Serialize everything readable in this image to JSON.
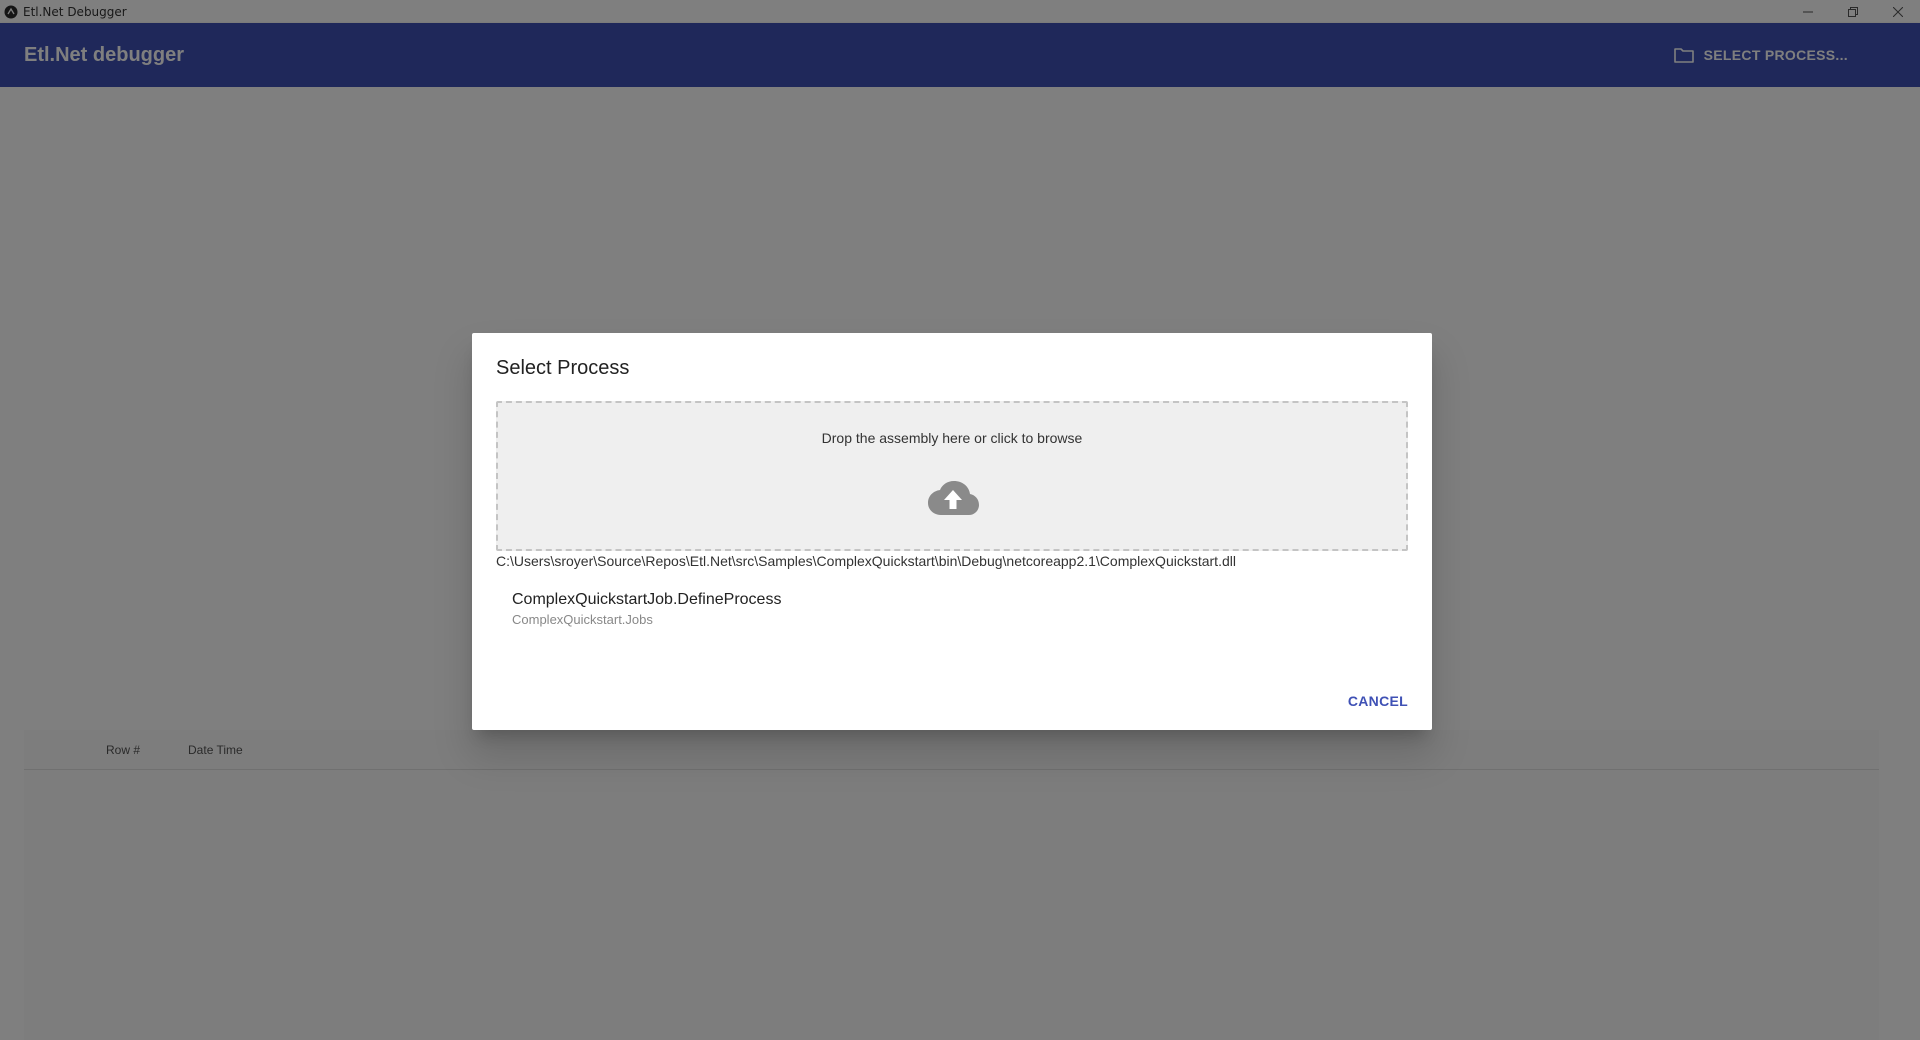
{
  "window": {
    "title": "Etl.Net Debugger",
    "icon": "app-logo-icon",
    "controls": [
      "minimize-icon",
      "restore-icon",
      "close-icon"
    ]
  },
  "appbar": {
    "title": "Etl.Net debugger",
    "select_process_label": "SELECT PROCESS...",
    "select_process_icon": "folder-icon",
    "color": "#3f51b5"
  },
  "grid": {
    "columns": [
      "Row #",
      "Date Time"
    ]
  },
  "dialog": {
    "title": "Select Process",
    "dropzone_text": "Drop the assembly here or click to browse",
    "dropzone_icon": "cloud-upload-icon",
    "file_path": "C:\\Users\\sroyer\\Source\\Repos\\Etl.Net\\src\\Samples\\ComplexQuickstart\\bin\\Debug\\netcoreapp2.1\\ComplexQuickstart.dll",
    "processes": [
      {
        "name": "ComplexQuickstartJob.DefineProcess",
        "namespace": "ComplexQuickstart.Jobs"
      }
    ],
    "cancel_label": "CANCEL"
  }
}
